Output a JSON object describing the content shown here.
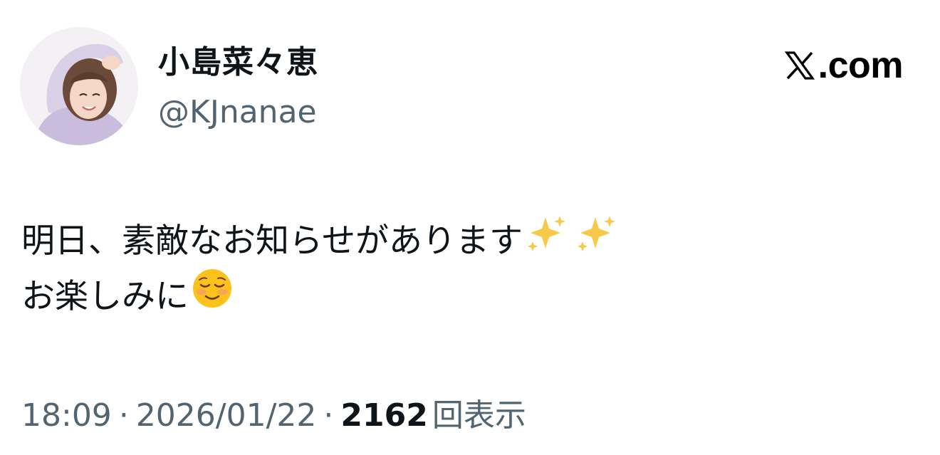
{
  "author": {
    "display_name": "小島菜々恵",
    "handle": "@KJnanae",
    "avatar_icon": "profile-photo"
  },
  "brand": {
    "label": ".com",
    "logo_icon": "x-logo-icon"
  },
  "tweet": {
    "line1": "明日、素敵なお知らせがあります",
    "line1_emoji": "sparkles-icon",
    "line2": "お楽しみに",
    "line2_emoji": "smiling-face-icon"
  },
  "meta": {
    "time": "18:09",
    "separator": "·",
    "date": "2026/01/22",
    "views_count": "2162",
    "views_label": "回表示"
  },
  "colors": {
    "text_primary": "#0f1419",
    "text_secondary": "#536471",
    "background": "#ffffff"
  }
}
